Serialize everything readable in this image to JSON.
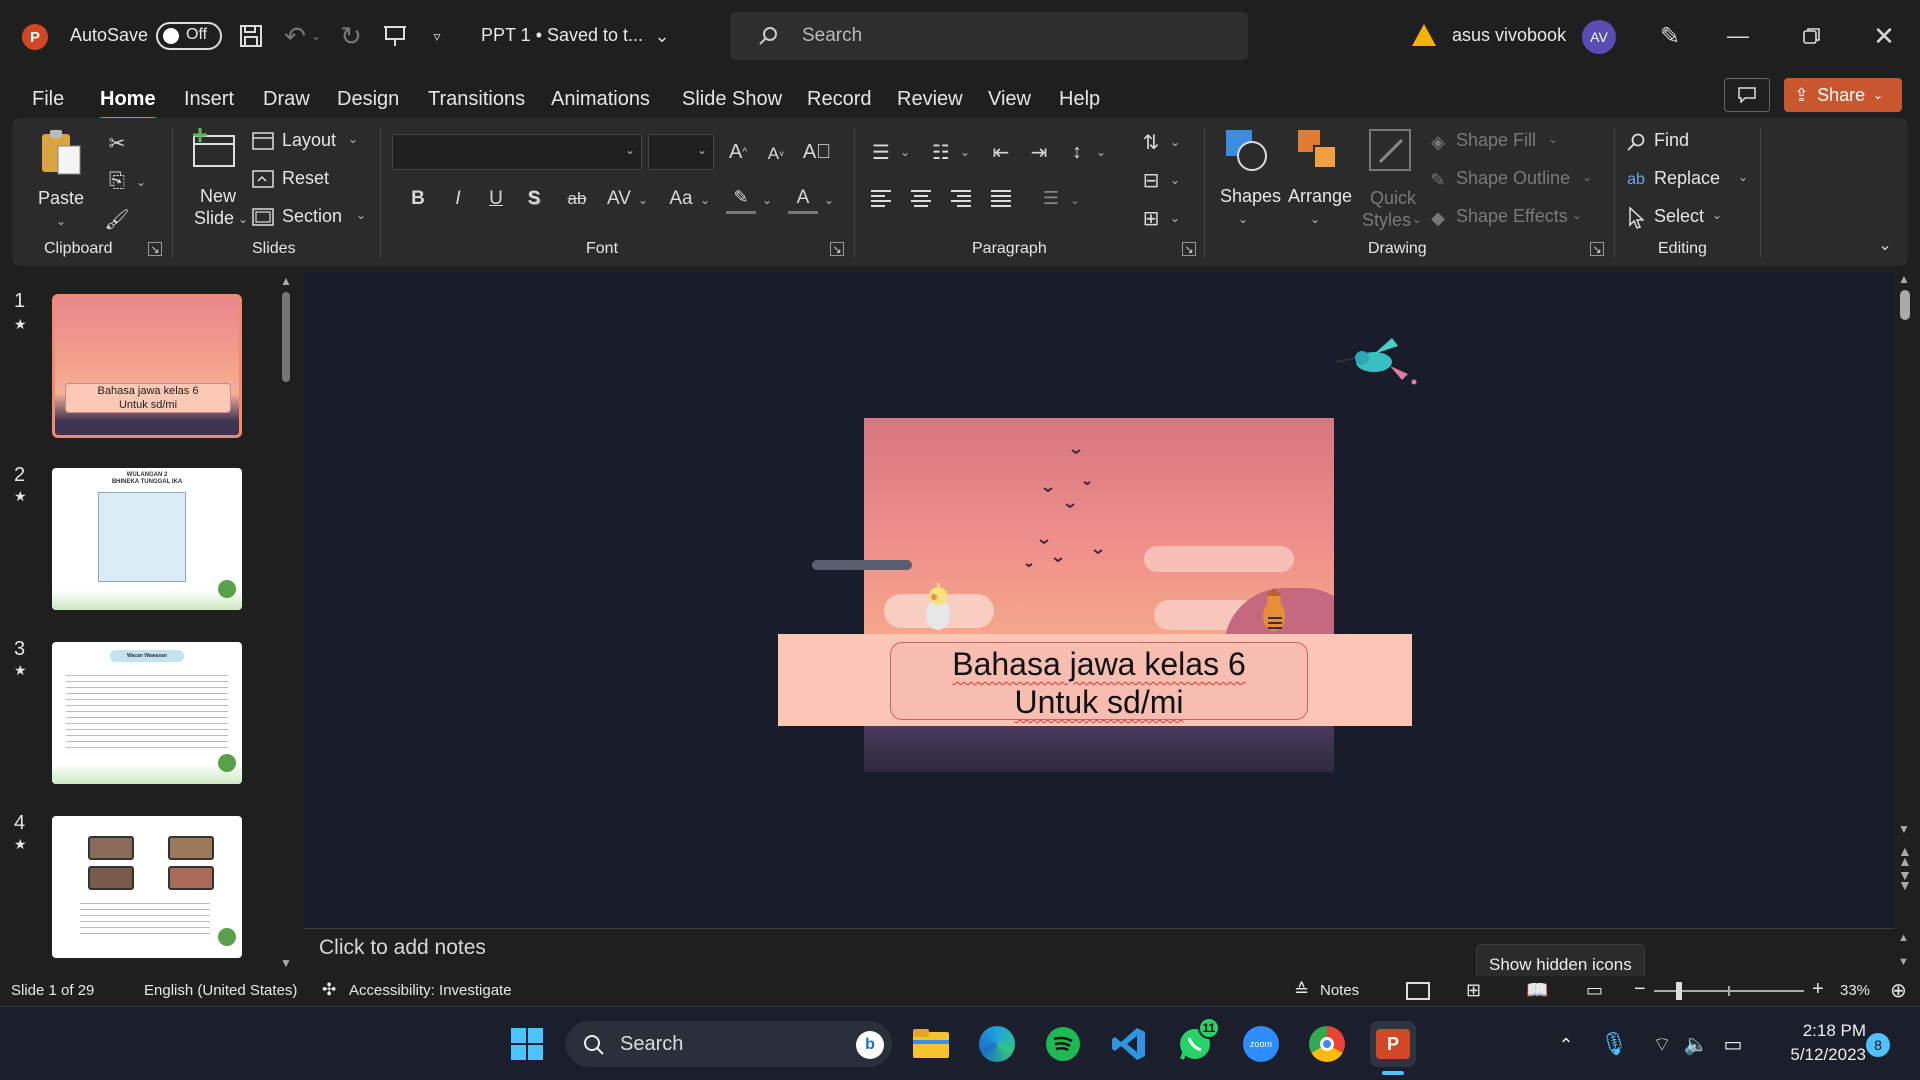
{
  "app": {
    "autosave_label": "AutoSave",
    "autosave_state": "Off",
    "doc_title": "PPT 1 • Saved to t...",
    "search_placeholder": "Search",
    "user_name": "asus vivobook",
    "user_initials": "AV"
  },
  "tabs": [
    "File",
    "Home",
    "Insert",
    "Draw",
    "Design",
    "Transitions",
    "Animations",
    "Slide Show",
    "Record",
    "Review",
    "View",
    "Help"
  ],
  "share_label": "Share",
  "ribbon": {
    "clipboard": {
      "paste": "Paste",
      "group": "Clipboard"
    },
    "slides": {
      "new_slide_1": "New",
      "new_slide_2": "Slide",
      "layout": "Layout",
      "reset": "Reset",
      "section": "Section",
      "group": "Slides"
    },
    "font": {
      "group": "Font",
      "bold": "B",
      "italic": "I",
      "underline": "U",
      "shadow": "S",
      "strike": "ab",
      "spacing": "AV",
      "case": "Aa"
    },
    "paragraph": {
      "group": "Paragraph"
    },
    "drawing": {
      "shapes": "Shapes",
      "arrange": "Arrange",
      "quick_styles_1": "Quick",
      "quick_styles_2": "Styles",
      "shape_fill": "Shape Fill",
      "shape_outline": "Shape Outline",
      "shape_effects": "Shape Effects",
      "group": "Drawing"
    },
    "editing": {
      "find": "Find",
      "replace": "Replace",
      "select": "Select",
      "group": "Editing"
    }
  },
  "thumbnails": [
    {
      "num": "1",
      "star": "★",
      "caption_1": "Bahasa jawa kelas 6",
      "caption_2": "Untuk sd/mi"
    },
    {
      "num": "2",
      "star": "★",
      "title_1": "WULANGAN 2",
      "title_2": "BHINEKA TUNGGAL IKA"
    },
    {
      "num": "3",
      "star": "★",
      "title": "Wacan Wawasan"
    },
    {
      "num": "4",
      "star": "★"
    }
  ],
  "slide": {
    "title_line_1": "Bahasa jawa kelas 6",
    "title_line_2": "Untuk sd/mi"
  },
  "notes_placeholder": "Click to add notes",
  "tooltip": "Show hidden icons",
  "status": {
    "slide_info": "Slide 1 of 29",
    "language": "English (United States)",
    "accessibility": "Accessibility: Investigate",
    "notes": "Notes",
    "zoom": "33%"
  },
  "taskbar": {
    "search": "Search",
    "whatsapp_badge": "11",
    "time": "2:18 PM",
    "date": "5/12/2023",
    "notification_count": "8"
  },
  "colors": {
    "accent": "#e0754d",
    "bg": "#1f1f1f",
    "ribbon": "#2b2b2b",
    "canvas": "#181c2b"
  }
}
